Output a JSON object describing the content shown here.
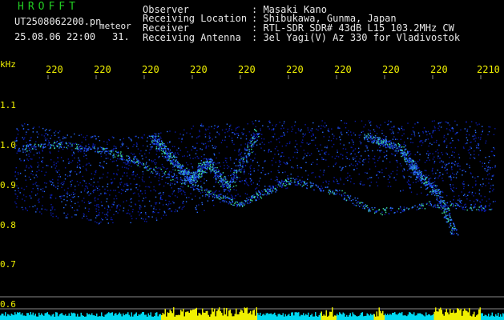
{
  "header": {
    "brand": "HROFFT",
    "filename": "UT2508062200.pn",
    "meteor_label": "meteor",
    "datetime": "25.08.06 22:00",
    "count": "31.",
    "info": [
      {
        "key": "Observer",
        "value": ": Masaki Kano"
      },
      {
        "key": "Receiving Location",
        "value": ": Shibukawa, Gunma, Japan"
      },
      {
        "key": "Receiver",
        "value": ": RTL-SDR SDR# 43dB L15 103.2MHz CW"
      },
      {
        "key": "Receiving Antenna",
        "value": ": 3el Yagi(V) Az 330 for Vladivostok"
      }
    ]
  },
  "axis": {
    "unit": "kHz",
    "x_ticks": [
      "220",
      "220",
      "220",
      "220",
      "220",
      "220",
      "220",
      "220",
      "220",
      "2210"
    ],
    "y_ticks": [
      "1.1",
      "1.0",
      "0.9",
      "0.8",
      "0.7",
      "0.6"
    ]
  },
  "colors": {
    "background": "#000000",
    "signal_low": "#0a1aa8",
    "signal_mid": "#2a6cff",
    "signal_high": "#40e0a0",
    "grid_line": "#888888",
    "level_bar_cyan": "#00d8f0",
    "level_bar_yellow": "#f0f000"
  }
}
